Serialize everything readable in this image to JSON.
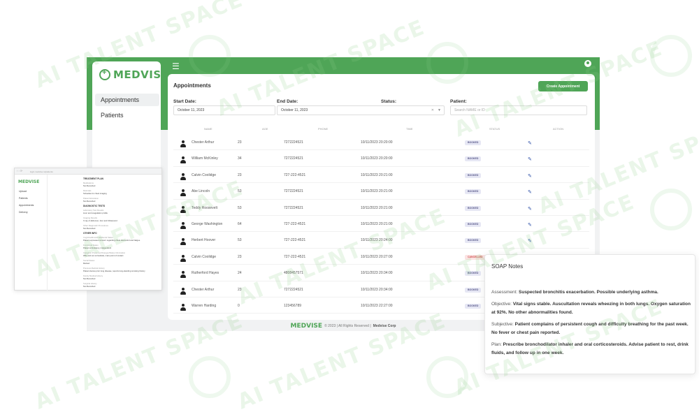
{
  "app": {
    "brand": "MEDVISE",
    "nav": [
      {
        "label": "Appointments",
        "active": true
      },
      {
        "label": "Patients",
        "active": false
      }
    ],
    "page_title": "Appointments",
    "create_button": "Create Appointment",
    "filters": {
      "start_label": "Start Date:",
      "start_value": "October 11, 2023",
      "end_label": "End Date:",
      "end_value": "October 11, 2023",
      "status_label": "Status:",
      "status_value": "",
      "patient_label": "Patient:",
      "patient_placeholder": "Search NAME or ID"
    },
    "columns": [
      "NAME",
      "AGE",
      "PHONE",
      "TIME",
      "STATUS",
      "ACTION"
    ],
    "rows": [
      {
        "name": "Chester Arthur",
        "age": "23",
        "phone": "7272224521",
        "time": "10/11/2023 20:20:00",
        "status": "BOOKED"
      },
      {
        "name": "William McKinley",
        "age": "34",
        "phone": "7272224521",
        "time": "10/11/2023 20:20:00",
        "status": "BOOKED"
      },
      {
        "name": "Calvin Coolidge",
        "age": "23",
        "phone": "727-222-4521",
        "time": "10/11/2023 20:21:00",
        "status": "BOOKED"
      },
      {
        "name": "Abe Lincoln",
        "age": "53",
        "phone": "7272224521",
        "time": "10/11/2023 20:21:00",
        "status": "BOOKED"
      },
      {
        "name": "Teddy Roosevelt",
        "age": "53",
        "phone": "7272224521",
        "time": "10/11/2023 20:21:00",
        "status": "BOOKED"
      },
      {
        "name": "George Washington",
        "age": "64",
        "phone": "727-222-4521",
        "time": "10/11/2023 20:21:00",
        "status": "BOOKED"
      },
      {
        "name": "Herbert Hoover",
        "age": "53",
        "phone": "727-222-4521",
        "time": "10/11/2023 20:24:00",
        "status": "BOOKED"
      },
      {
        "name": "Calvin Coolidge",
        "age": "23",
        "phone": "727-222-4521",
        "time": "10/11/2023 20:27:00",
        "status": "CANCELLED"
      },
      {
        "name": "Rutherford Hayes",
        "age": "24",
        "phone": "4808457571",
        "time": "10/11/2023 20:34:00",
        "status": "BOOKED"
      },
      {
        "name": "Chester Arthur",
        "age": "23",
        "phone": "7272224521",
        "time": "10/11/2023 20:34:00",
        "status": "BOOKED"
      },
      {
        "name": "Warren Harding",
        "age": "0",
        "phone": "123456789",
        "time": "10/11/2023 22:27:00",
        "status": "BOOKED"
      }
    ],
    "footer": {
      "brand": "MEDVISE",
      "copyright": "© 2023 | All Rights Reserved |",
      "company": "Medvise Corp"
    }
  },
  "mini_window": {
    "url": "login.medvise.io/patients",
    "brand": "MEDVISE",
    "nav": [
      "Upload",
      "Patients",
      "Appointments",
      "Delivery"
    ],
    "sections": [
      {
        "title": "TREATMENT PLAN",
        "fields": [
          {
            "label": "Medications",
            "value": "Not Recorded"
          },
          {
            "label": "Referrals",
            "value": "Schedule for chest imaging"
          },
          {
            "label": "Patient Education",
            "value": "Not Recorded"
          }
        ]
      },
      {
        "title": "DIAGNOSTIC TESTS",
        "fields": [
          {
            "label": "Laboratory Test Results",
            "value": "Liver and coagulation profile"
          },
          {
            "label": "Imaging Results",
            "value": "X-ray of abdomen, liver and Ultrasound"
          },
          {
            "label": "Other Diagnostic Procedures",
            "value": "Not Recorded"
          }
        ]
      },
      {
        "title": "OTHER INFO",
        "fields": [
          {
            "label": "Cognitive/Emotional/Mental Status",
            "value": "Patient expresses concern regarding chest discomfort and fatigue"
          },
          {
            "label": "Functional Status",
            "value": "Patient ambulatory, independent"
          },
          {
            "label": "Caregiver Presence/Changes/Status Information",
            "value": "Wife and son at bedside, main point of contact"
          },
          {
            "label": "Social Status",
            "value": "Retired"
          },
          {
            "label": "Previous Medical History",
            "value": "Patient denies prior lung disease, reports long-standing smoking history"
          },
          {
            "label": "Family Medical History",
            "value": "Not Recorded"
          },
          {
            "label": "Surgical History",
            "value": "Not Recorded"
          }
        ]
      }
    ]
  },
  "soap": {
    "title": "SOAP Notes",
    "items": [
      {
        "key": "Assessment:",
        "value": "Suspected bronchitis exacerbation. Possible underlying asthma."
      },
      {
        "key": "Objective:",
        "value": "Vital signs stable. Auscultation reveals wheezing in both lungs. Oxygen saturation at 92%. No other abnormalities found."
      },
      {
        "key": "Subjective:",
        "value": "Patient complains of persistent cough and difficulty breathing for the past week. No fever or chest pain reported."
      },
      {
        "key": "Plan:",
        "value": "Prescribe bronchodilator inhaler and oral corticosteroids. Advise patient to rest, drink fluids, and follow up in one week."
      }
    ]
  },
  "watermark": {
    "text": "AI TALENT SPACE"
  },
  "colors": {
    "brand_green": "#4fa557",
    "booked_badge": "#e6e7f4",
    "cancelled_badge": "#fbe3e3",
    "edit_icon": "#2c4fa8"
  }
}
